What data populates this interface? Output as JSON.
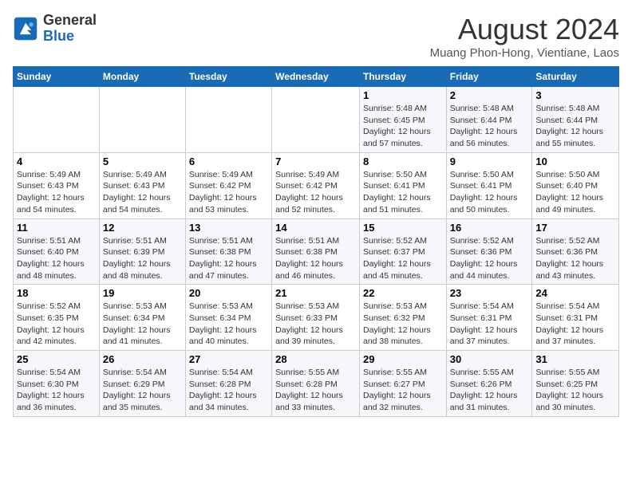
{
  "header": {
    "logo_line1": "General",
    "logo_line2": "Blue",
    "month_title": "August 2024",
    "location": "Muang Phon-Hong, Vientiane, Laos"
  },
  "days_of_week": [
    "Sunday",
    "Monday",
    "Tuesday",
    "Wednesday",
    "Thursday",
    "Friday",
    "Saturday"
  ],
  "weeks": [
    [
      {
        "day": "",
        "detail": ""
      },
      {
        "day": "",
        "detail": ""
      },
      {
        "day": "",
        "detail": ""
      },
      {
        "day": "",
        "detail": ""
      },
      {
        "day": "1",
        "detail": "Sunrise: 5:48 AM\nSunset: 6:45 PM\nDaylight: 12 hours\nand 57 minutes."
      },
      {
        "day": "2",
        "detail": "Sunrise: 5:48 AM\nSunset: 6:44 PM\nDaylight: 12 hours\nand 56 minutes."
      },
      {
        "day": "3",
        "detail": "Sunrise: 5:48 AM\nSunset: 6:44 PM\nDaylight: 12 hours\nand 55 minutes."
      }
    ],
    [
      {
        "day": "4",
        "detail": "Sunrise: 5:49 AM\nSunset: 6:43 PM\nDaylight: 12 hours\nand 54 minutes."
      },
      {
        "day": "5",
        "detail": "Sunrise: 5:49 AM\nSunset: 6:43 PM\nDaylight: 12 hours\nand 54 minutes."
      },
      {
        "day": "6",
        "detail": "Sunrise: 5:49 AM\nSunset: 6:42 PM\nDaylight: 12 hours\nand 53 minutes."
      },
      {
        "day": "7",
        "detail": "Sunrise: 5:49 AM\nSunset: 6:42 PM\nDaylight: 12 hours\nand 52 minutes."
      },
      {
        "day": "8",
        "detail": "Sunrise: 5:50 AM\nSunset: 6:41 PM\nDaylight: 12 hours\nand 51 minutes."
      },
      {
        "day": "9",
        "detail": "Sunrise: 5:50 AM\nSunset: 6:41 PM\nDaylight: 12 hours\nand 50 minutes."
      },
      {
        "day": "10",
        "detail": "Sunrise: 5:50 AM\nSunset: 6:40 PM\nDaylight: 12 hours\nand 49 minutes."
      }
    ],
    [
      {
        "day": "11",
        "detail": "Sunrise: 5:51 AM\nSunset: 6:40 PM\nDaylight: 12 hours\nand 48 minutes."
      },
      {
        "day": "12",
        "detail": "Sunrise: 5:51 AM\nSunset: 6:39 PM\nDaylight: 12 hours\nand 48 minutes."
      },
      {
        "day": "13",
        "detail": "Sunrise: 5:51 AM\nSunset: 6:38 PM\nDaylight: 12 hours\nand 47 minutes."
      },
      {
        "day": "14",
        "detail": "Sunrise: 5:51 AM\nSunset: 6:38 PM\nDaylight: 12 hours\nand 46 minutes."
      },
      {
        "day": "15",
        "detail": "Sunrise: 5:52 AM\nSunset: 6:37 PM\nDaylight: 12 hours\nand 45 minutes."
      },
      {
        "day": "16",
        "detail": "Sunrise: 5:52 AM\nSunset: 6:36 PM\nDaylight: 12 hours\nand 44 minutes."
      },
      {
        "day": "17",
        "detail": "Sunrise: 5:52 AM\nSunset: 6:36 PM\nDaylight: 12 hours\nand 43 minutes."
      }
    ],
    [
      {
        "day": "18",
        "detail": "Sunrise: 5:52 AM\nSunset: 6:35 PM\nDaylight: 12 hours\nand 42 minutes."
      },
      {
        "day": "19",
        "detail": "Sunrise: 5:53 AM\nSunset: 6:34 PM\nDaylight: 12 hours\nand 41 minutes."
      },
      {
        "day": "20",
        "detail": "Sunrise: 5:53 AM\nSunset: 6:34 PM\nDaylight: 12 hours\nand 40 minutes."
      },
      {
        "day": "21",
        "detail": "Sunrise: 5:53 AM\nSunset: 6:33 PM\nDaylight: 12 hours\nand 39 minutes."
      },
      {
        "day": "22",
        "detail": "Sunrise: 5:53 AM\nSunset: 6:32 PM\nDaylight: 12 hours\nand 38 minutes."
      },
      {
        "day": "23",
        "detail": "Sunrise: 5:54 AM\nSunset: 6:31 PM\nDaylight: 12 hours\nand 37 minutes."
      },
      {
        "day": "24",
        "detail": "Sunrise: 5:54 AM\nSunset: 6:31 PM\nDaylight: 12 hours\nand 37 minutes."
      }
    ],
    [
      {
        "day": "25",
        "detail": "Sunrise: 5:54 AM\nSunset: 6:30 PM\nDaylight: 12 hours\nand 36 minutes."
      },
      {
        "day": "26",
        "detail": "Sunrise: 5:54 AM\nSunset: 6:29 PM\nDaylight: 12 hours\nand 35 minutes."
      },
      {
        "day": "27",
        "detail": "Sunrise: 5:54 AM\nSunset: 6:28 PM\nDaylight: 12 hours\nand 34 minutes."
      },
      {
        "day": "28",
        "detail": "Sunrise: 5:55 AM\nSunset: 6:28 PM\nDaylight: 12 hours\nand 33 minutes."
      },
      {
        "day": "29",
        "detail": "Sunrise: 5:55 AM\nSunset: 6:27 PM\nDaylight: 12 hours\nand 32 minutes."
      },
      {
        "day": "30",
        "detail": "Sunrise: 5:55 AM\nSunset: 6:26 PM\nDaylight: 12 hours\nand 31 minutes."
      },
      {
        "day": "31",
        "detail": "Sunrise: 5:55 AM\nSunset: 6:25 PM\nDaylight: 12 hours\nand 30 minutes."
      }
    ]
  ]
}
